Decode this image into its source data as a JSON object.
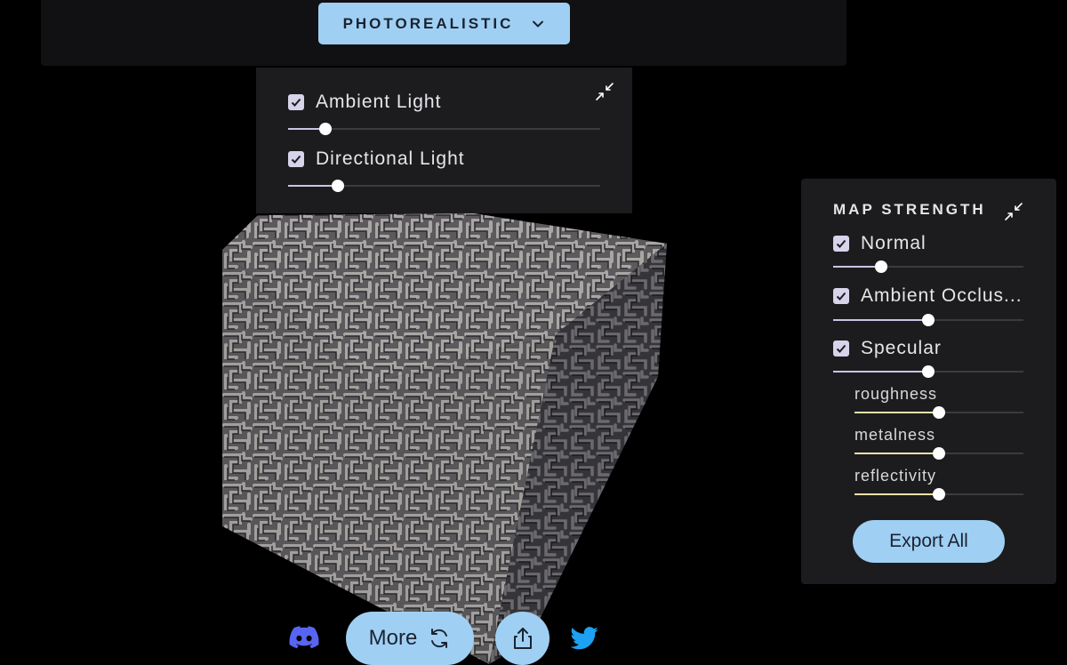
{
  "header": {
    "mode_label": "PHOTOREALISTIC"
  },
  "lighting": {
    "items": [
      {
        "label": "Ambient Light",
        "checked": true,
        "value": 0.12
      },
      {
        "label": "Directional Light",
        "checked": true,
        "value": 0.16
      }
    ]
  },
  "map_strength": {
    "title": "MAP STRENGTH",
    "items": [
      {
        "label": "Normal",
        "checked": true,
        "value": 0.25
      },
      {
        "label": "Ambient Occlus...",
        "checked": true,
        "value": 0.5
      },
      {
        "label": "Specular",
        "checked": true,
        "value": 0.5
      }
    ],
    "specular_params": [
      {
        "label": "roughness",
        "value": 0.5
      },
      {
        "label": "metalness",
        "value": 0.5
      },
      {
        "label": "reflectivity",
        "value": 0.5
      }
    ],
    "export_label": "Export All"
  },
  "footer": {
    "more_label": "More"
  },
  "colors": {
    "accent": "#9fd0f4",
    "panel": "#1c1c1f",
    "checkbox": "#d6d3ea",
    "discord": "#5865f2",
    "twitter": "#1da1f2"
  },
  "icons": [
    "chevron-down-icon",
    "collapse-icon",
    "check-icon",
    "refresh-icon",
    "share-icon",
    "discord-icon",
    "twitter-icon"
  ]
}
